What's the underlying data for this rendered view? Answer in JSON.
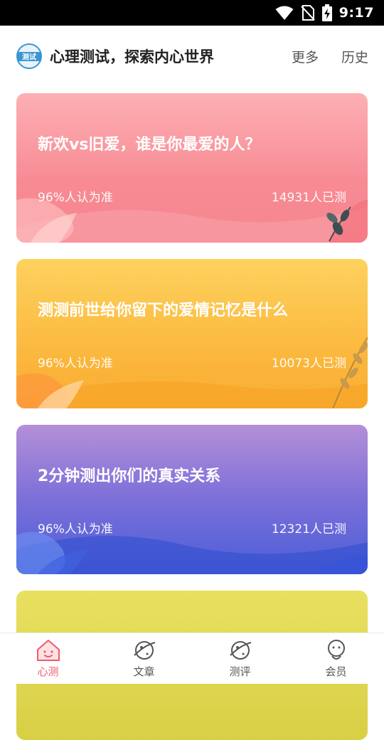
{
  "status_bar": {
    "time": "9:17"
  },
  "header": {
    "logo_text": "测试",
    "title": "心理测试，探索内心世界",
    "more": "更多",
    "history": "历史"
  },
  "cards": [
    {
      "title": "新欢vs旧爱，谁是你最爱的人？",
      "rating": "96%人认为准",
      "count": "14931人已测"
    },
    {
      "title": "测测前世给你留下的爱情记忆是什么",
      "rating": "96%人认为准",
      "count": "10073人已测"
    },
    {
      "title": "2分钟测出你们的真实关系",
      "rating": "96%人认为准",
      "count": "12321人已测"
    },
    {
      "title": "",
      "rating": "",
      "count": ""
    }
  ],
  "bottom_nav": {
    "tabs": [
      {
        "label": "心测",
        "icon": "house-face-icon",
        "active": true
      },
      {
        "label": "文章",
        "icon": "planet-icon",
        "active": false
      },
      {
        "label": "测评",
        "icon": "planet-icon",
        "active": false
      },
      {
        "label": "会员",
        "icon": "person-icon",
        "active": false
      }
    ]
  },
  "colors": {
    "accent": "#ef5a6b",
    "card1": "#f78a93",
    "card2": "#fbb53a",
    "card3": "#6a67d9",
    "card4": "#dcd24a"
  }
}
